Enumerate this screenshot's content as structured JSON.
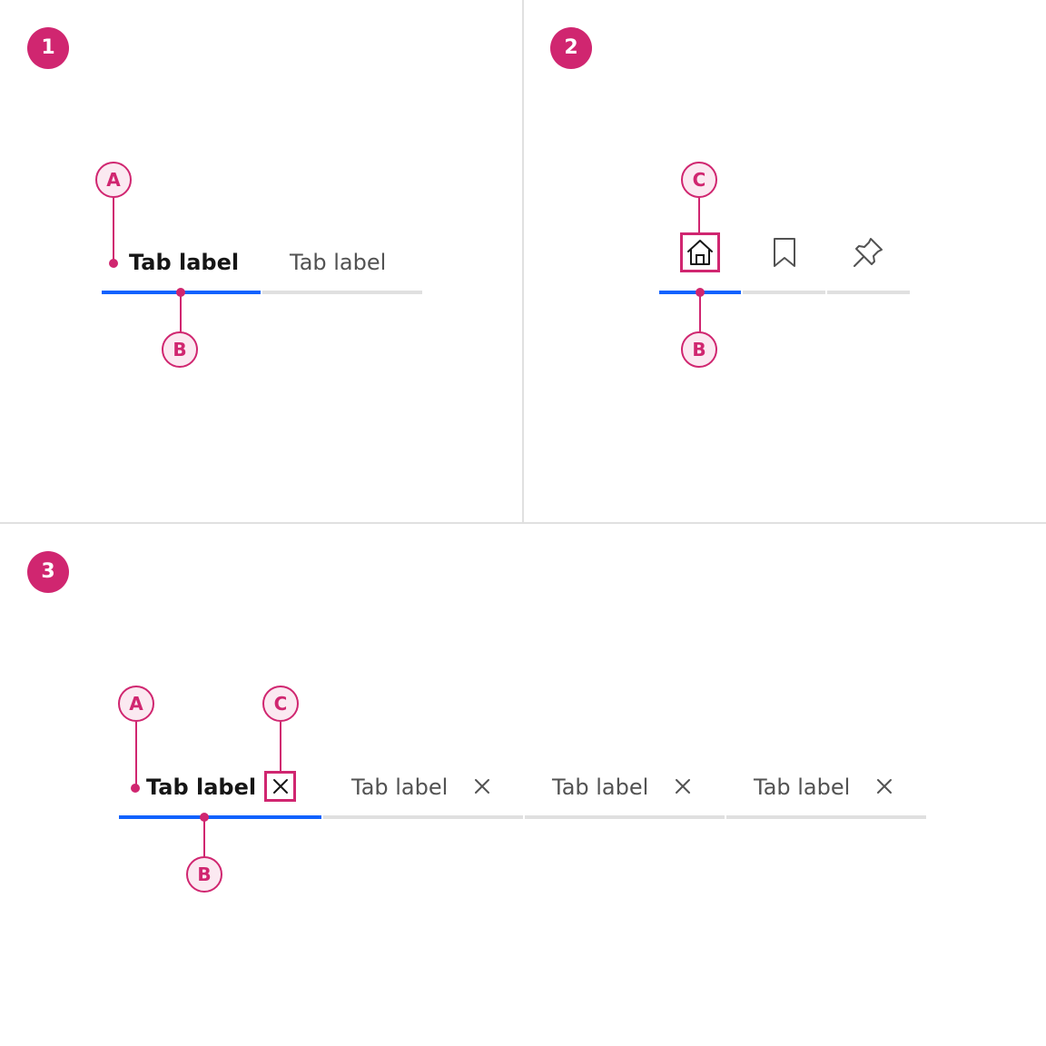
{
  "steps": [
    "1",
    "2",
    "3"
  ],
  "callouts": {
    "a": "A",
    "b": "B",
    "c": "C"
  },
  "panel1": {
    "tabs": [
      {
        "label": "Tab label",
        "selected": true
      },
      {
        "label": "Tab label",
        "selected": false
      }
    ]
  },
  "panel2": {
    "tabs": [
      {
        "icon": "home-icon",
        "selected": true
      },
      {
        "icon": "bookmark-icon",
        "selected": false
      },
      {
        "icon": "pin-icon",
        "selected": false
      }
    ]
  },
  "panel3": {
    "tabs": [
      {
        "label": "Tab label",
        "selected": true,
        "icon": "close-icon"
      },
      {
        "label": "Tab label",
        "selected": false,
        "icon": "close-icon"
      },
      {
        "label": "Tab label",
        "selected": false,
        "icon": "close-icon"
      },
      {
        "label": "Tab label",
        "selected": false,
        "icon": "close-icon"
      }
    ]
  },
  "colors": {
    "annotation": "#d02670",
    "annotation_fill": "#fbe9f1",
    "active_indicator": "#0f62fe",
    "inactive_track": "#e0e0e0",
    "selected_text": "#161616",
    "unselected_text": "#525252"
  }
}
